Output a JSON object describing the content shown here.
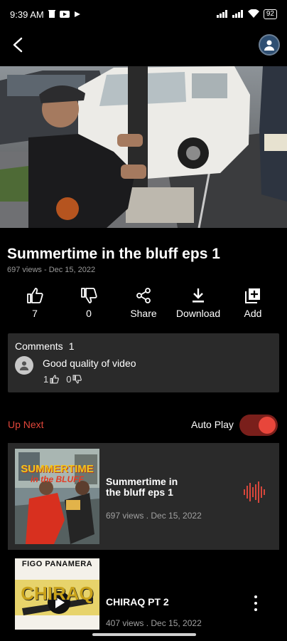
{
  "status_bar": {
    "time": "9:39 AM",
    "battery": "92"
  },
  "video": {
    "title": "Summertime in the bluff eps 1",
    "meta": "697 views - Dec 15, 2022"
  },
  "actions": {
    "like_count": "7",
    "dislike_count": "0",
    "share_label": "Share",
    "download_label": "Download",
    "add_label": "Add"
  },
  "comments": {
    "title": "Comments",
    "count": "1",
    "top_comment": "Good quality of video",
    "likes": "1",
    "dislikes": "0"
  },
  "up_next": {
    "label": "Up Next",
    "autoplay_label": "Auto Play",
    "autoplay_on": true,
    "items": [
      {
        "title": "Summertime in the bluff eps 1",
        "meta": "697 views . Dec 15, 2022",
        "thumb_top_text": "SUMMERTIME",
        "thumb_sub_text": "in the BLUFF",
        "playing": true
      },
      {
        "title": "CHIRAQ PT 2",
        "meta": "407 views . Dec 15, 2022",
        "thumb_top_text": "FIGO PANAMERA",
        "thumb_sub_text": "CHIRAQ"
      }
    ]
  },
  "icons": {
    "back": "arrow-left-icon",
    "profile": "user-avatar-icon",
    "like": "thumbs-up-icon",
    "dislike": "thumbs-down-icon",
    "share": "share-icon",
    "download": "download-icon",
    "add": "add-to-playlist-icon",
    "playing": "sound-wave-icon",
    "more": "more-vert-icon"
  },
  "colors": {
    "accent": "#e8463b",
    "card_bg": "#2a2a2a",
    "background": "#000000"
  }
}
